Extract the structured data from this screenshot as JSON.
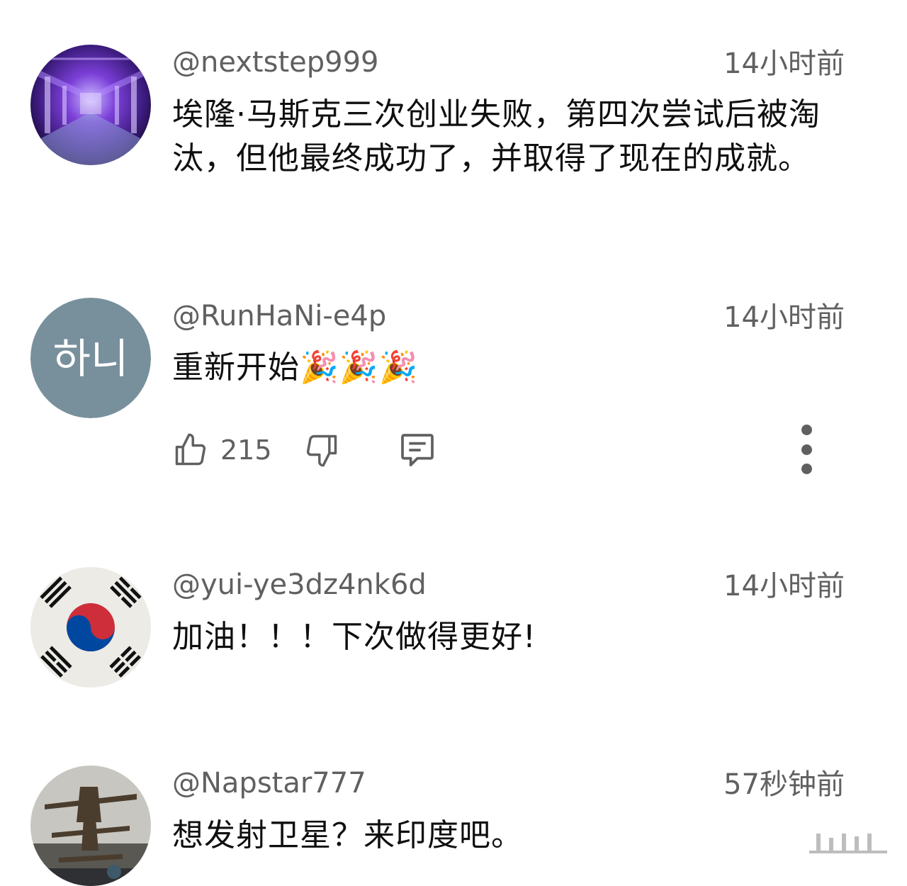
{
  "comments": [
    {
      "author": "@nextstep999",
      "time": "14小时前",
      "text": "埃隆·马斯克三次创业失败，第四次尝试后被淘汰，但他最终成功了，并取得了现在的成就。",
      "avatar": "tunnel-photo"
    },
    {
      "author": "@RunHaNi-e4p",
      "time": "14小时前",
      "text": "重新开始",
      "emoji": "🎉🎉🎉",
      "avatar_text": "하니",
      "avatar_color": "#78909c",
      "likes": "215"
    },
    {
      "author": "@yui-ye3dz4nk6d",
      "time": "14小时前",
      "text": "加油！！！下次做得更好!",
      "avatar": "korean-flag"
    },
    {
      "author": "@Napstar777",
      "time": "57秒钟前",
      "text": "想发射卫星？来印度吧。",
      "avatar": "aircraft-photo"
    }
  ],
  "icons": {
    "like": "thumbs-up-icon",
    "dislike": "thumbs-down-icon",
    "reply": "comment-icon",
    "more": "more-vertical-icon"
  },
  "colors": {
    "secondary_text": "#606060",
    "primary_text": "#0f0f0f"
  }
}
